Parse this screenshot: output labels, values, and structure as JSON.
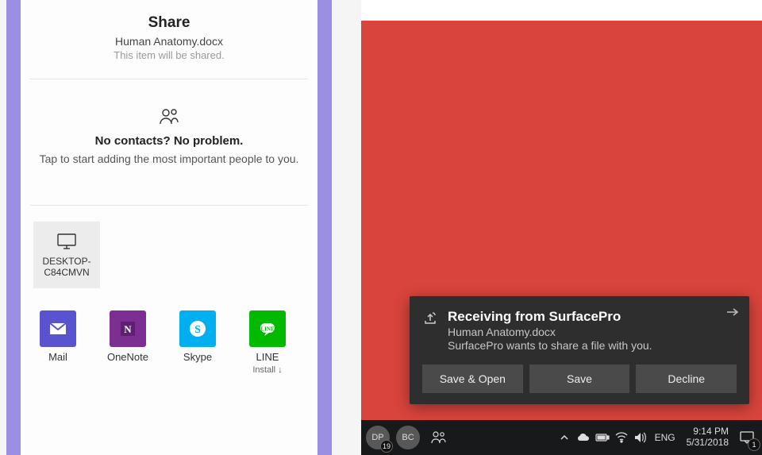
{
  "share": {
    "title": "Share",
    "filename": "Human Anatomy.docx",
    "note": "This item will be shared.",
    "contactsHeading": "No contacts? No problem.",
    "contactsSub": "Tap to start adding the most important people to you.",
    "device": {
      "name": "DESKTOP-C84CMVN"
    },
    "apps": {
      "mail": "Mail",
      "onenote": "OneNote",
      "skype": "Skype",
      "line": "LINE",
      "lineInstall": "Install ↓"
    }
  },
  "toast": {
    "title": "Receiving from SurfacePro",
    "file": "Human Anatomy.docx",
    "message": "SurfacePro wants to share a file with you.",
    "actions": {
      "saveOpen": "Save & Open",
      "save": "Save",
      "decline": "Decline"
    }
  },
  "taskbar": {
    "avatar1": "DP",
    "avatar1Badge": "19",
    "avatar2": "BC",
    "lang": "ENG",
    "time": "9:14 PM",
    "date": "5/31/2018",
    "actionBadge": "1"
  }
}
